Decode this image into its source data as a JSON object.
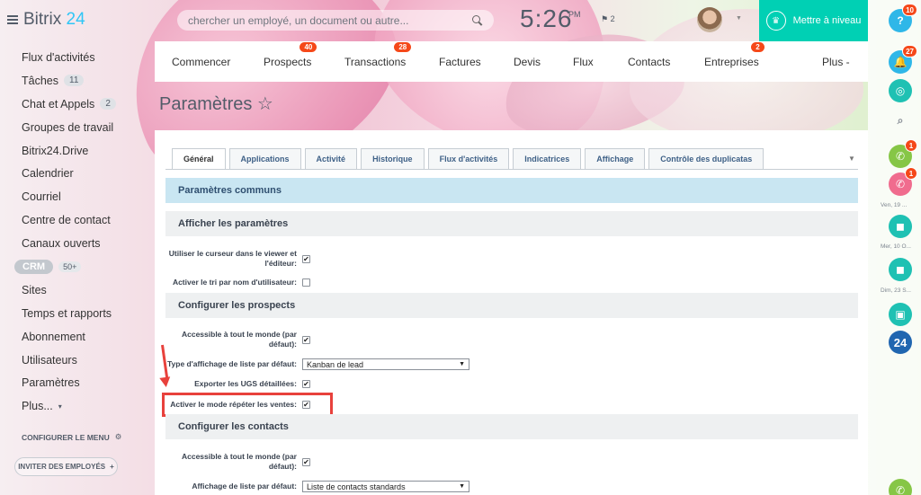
{
  "app": {
    "logo_prefix": "Bitrix",
    "logo_suffix": "24"
  },
  "sidebar": {
    "items": [
      {
        "label": "Flux d'activités",
        "counter": ""
      },
      {
        "label": "Tâches",
        "counter": "11"
      },
      {
        "label": "Chat et Appels",
        "counter": "2"
      },
      {
        "label": "Groupes de travail",
        "counter": ""
      },
      {
        "label": "Bitrix24.Drive",
        "counter": ""
      },
      {
        "label": "Calendrier",
        "counter": ""
      },
      {
        "label": "Courriel",
        "counter": ""
      },
      {
        "label": "Centre de contact",
        "counter": ""
      },
      {
        "label": "Canaux ouverts",
        "counter": ""
      },
      {
        "label": "CRM",
        "counter": "50+"
      },
      {
        "label": "Sites",
        "counter": ""
      },
      {
        "label": "Temps et rapports",
        "counter": ""
      },
      {
        "label": "Abonnement",
        "counter": ""
      },
      {
        "label": "Utilisateurs",
        "counter": ""
      },
      {
        "label": "Paramètres",
        "counter": ""
      },
      {
        "label": "Plus...",
        "counter": ""
      }
    ],
    "configure_label": "CONFIGURER LE MENU",
    "invite_label": "INVITER DES EMPLOYÉS"
  },
  "header": {
    "search_placeholder": "chercher un employé, un document ou autre...",
    "clock": "5:26",
    "ampm": "PM",
    "flag_count": "2",
    "upgrade_label": "Mettre à niveau"
  },
  "rail": {
    "help_badge": "10",
    "notif_badge": "27",
    "call1_badge": "1",
    "call2_badge": "1",
    "date1": "Ven, 19 ...",
    "date2": "Mer, 10 O...",
    "date3": "Dim, 23 S...",
    "b24_label": "24"
  },
  "topnav": {
    "items": [
      {
        "label": "Commencer",
        "badge": ""
      },
      {
        "label": "Prospects",
        "badge": "40"
      },
      {
        "label": "Transactions",
        "badge": "28"
      },
      {
        "label": "Factures",
        "badge": ""
      },
      {
        "label": "Devis",
        "badge": ""
      },
      {
        "label": "Flux",
        "badge": ""
      },
      {
        "label": "Contacts",
        "badge": ""
      },
      {
        "label": "Entreprises",
        "badge": "2"
      },
      {
        "label": "Plus -",
        "badge": ""
      }
    ]
  },
  "page": {
    "title": "Paramètres ☆"
  },
  "tabs": [
    "Général",
    "Applications",
    "Activité",
    "Historique",
    "Flux d'activités",
    "Indicatrices",
    "Affichage",
    "Contrôle des duplicatas"
  ],
  "sections": {
    "common": "Paramètres communs",
    "display": "Afficher les paramètres",
    "leads": "Configurer les prospects",
    "contacts": "Configurer les contacts"
  },
  "settings": {
    "cursor_viewer": "Utiliser le curseur dans le viewer et l'éditeur:",
    "sort_by_name": "Activer le tri par nom d'utilisateur:",
    "leads_public": "Accessible à tout le monde (par défaut):",
    "leads_list_type": "Type d'affichage de liste par défaut:",
    "leads_list_value": "Kanban de lead",
    "export_skus": "Exporter les UGS détaillées:",
    "repeat_sales": "Activer le mode répéter les ventes:",
    "contacts_public": "Accessible à tout le monde (par défaut):",
    "contacts_list": "Affichage de liste par défaut:",
    "contacts_list_value": "Liste de contacts standards"
  }
}
